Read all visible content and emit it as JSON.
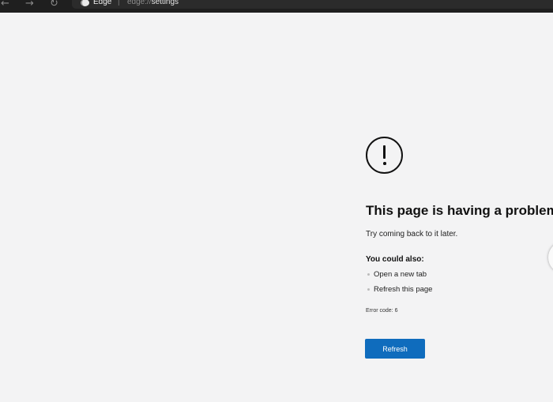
{
  "browser": {
    "nav": {
      "back_icon": "arrow-left-icon",
      "forward_icon": "arrow-right-icon",
      "refresh_icon": "refresh-icon"
    },
    "tab": {
      "site_name": "Edge",
      "url_prefix": "edge://",
      "url_path": "settings"
    }
  },
  "error_page": {
    "icon": "exclamation-circle-icon",
    "title": "This page is having a problem",
    "subtitle": "Try coming back to it later.",
    "suggestions_label": "You could also:",
    "suggestions": [
      "Open a new tab",
      "Refresh this page"
    ],
    "error_code": "Error code: 6",
    "refresh_label": "Refresh",
    "accent_color": "#0f6cbd"
  }
}
